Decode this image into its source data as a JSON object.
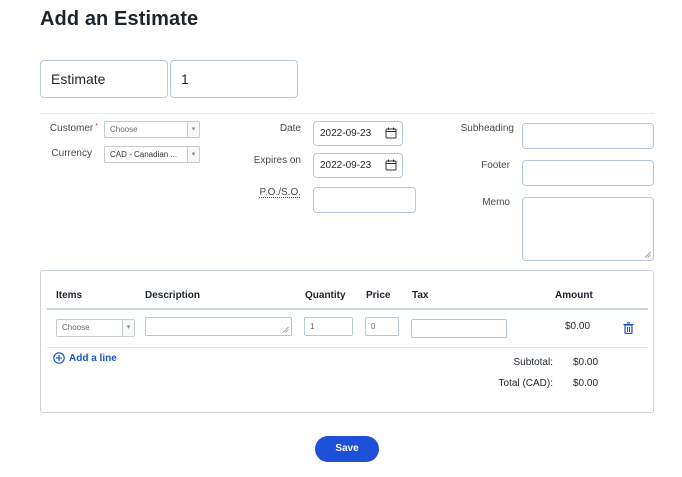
{
  "page": {
    "title": "Add an Estimate"
  },
  "header": {
    "doc_type": "Estimate",
    "doc_number": "1"
  },
  "customer": {
    "label": "Customer",
    "required_mark": "*",
    "placeholder": "Choose"
  },
  "currency": {
    "label": "Currency",
    "value": "CAD - Canadian ..."
  },
  "date": {
    "label": "Date",
    "value": "2022-09-23"
  },
  "expires": {
    "label": "Expires on",
    "value": "2022-09-23"
  },
  "po": {
    "label": "P.O./S.O.",
    "value": ""
  },
  "subheading": {
    "label": "Subheading",
    "value": ""
  },
  "footer": {
    "label": "Footer",
    "value": ""
  },
  "memo": {
    "label": "Memo",
    "value": ""
  },
  "items_table": {
    "columns": [
      "Items",
      "Description",
      "Quantity",
      "Price",
      "Tax",
      "Amount"
    ],
    "rows": [
      {
        "item": "Choose",
        "description": "",
        "quantity": "1",
        "price": "0",
        "tax": "",
        "amount": "$0.00"
      }
    ],
    "add_line_label": "Add a line"
  },
  "totals": {
    "subtotal_label": "Subtotal:",
    "subtotal_value": "$0.00",
    "total_label": "Total (CAD):",
    "total_value": "$0.00"
  },
  "actions": {
    "save_label": "Save"
  },
  "colors": {
    "primary": "#1d4fd8",
    "link": "#1a55c5",
    "border": "#b5c7da"
  },
  "icons": [
    "calendar-icon",
    "trash-icon",
    "plus-circle-icon",
    "chevron-down-icon"
  ]
}
